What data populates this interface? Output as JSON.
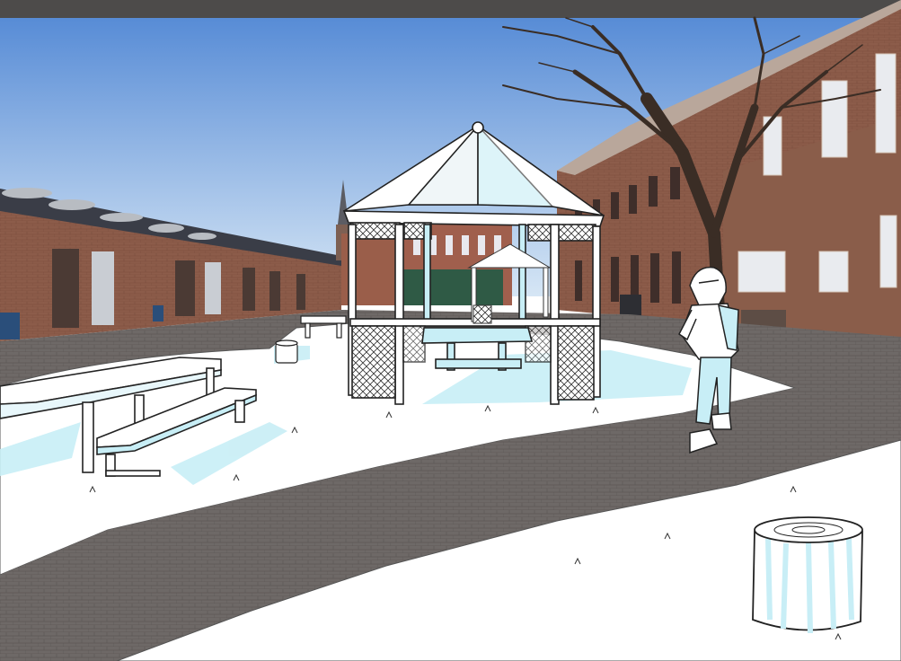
{
  "scene": {
    "description_type": "mixed photo and line-art illustration",
    "colors": {
      "sky_top": "#5a8fd6",
      "sky_bottom": "#cfe1f4",
      "brick": "#8a5a48",
      "brick_dark": "#6e4436",
      "roof": "#3d3f48",
      "pavement": "#6f6a68",
      "pavement_light": "#8a8582",
      "snow": "#ffffff",
      "ice_tint": "#c8eef6",
      "ink": "#222222"
    }
  }
}
